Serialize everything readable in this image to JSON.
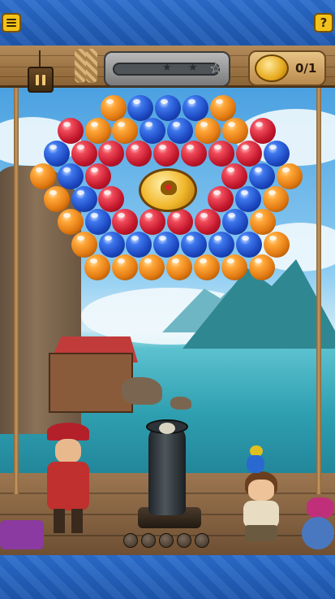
{
  "header": {
    "menu_icon": "menu-icon",
    "help_label": "?"
  },
  "hud": {
    "pause_icon": "pause-icon",
    "progress_fraction": 0,
    "stars_total": 3,
    "goal_icon": "gold-coin-icon",
    "goal_count": "0/1"
  },
  "board": {
    "colors": {
      "red": "#c3172c",
      "blue": "#1d49c2",
      "orange": "#e27a12"
    },
    "rows": [
      [
        "orange",
        "blue",
        "blue",
        "blue",
        "orange"
      ],
      [
        "red",
        "orange",
        "orange",
        "blue",
        "blue",
        "orange",
        "orange",
        "red"
      ],
      [
        "blue",
        "red",
        "red",
        "red",
        "red",
        "red",
        "red",
        "red",
        "blue"
      ],
      [
        "orange",
        "blue",
        "red",
        "",
        "",
        "",
        "red",
        "blue",
        "orange"
      ],
      [
        "orange",
        "blue",
        "red",
        "",
        "",
        "",
        "red",
        "blue",
        "orange"
      ],
      [
        "orange",
        "blue",
        "red",
        "red",
        "red",
        "red",
        "blue",
        "orange"
      ],
      [
        "orange",
        "blue",
        "blue",
        "blue",
        "blue",
        "blue",
        "blue",
        "orange"
      ],
      [
        "orange",
        "orange",
        "orange",
        "orange",
        "orange",
        "orange",
        "orange"
      ]
    ],
    "target_icon": "gold-coin-icon"
  },
  "launcher": {
    "cannon_icon": "cannon-icon",
    "ammo_remaining": 5
  }
}
